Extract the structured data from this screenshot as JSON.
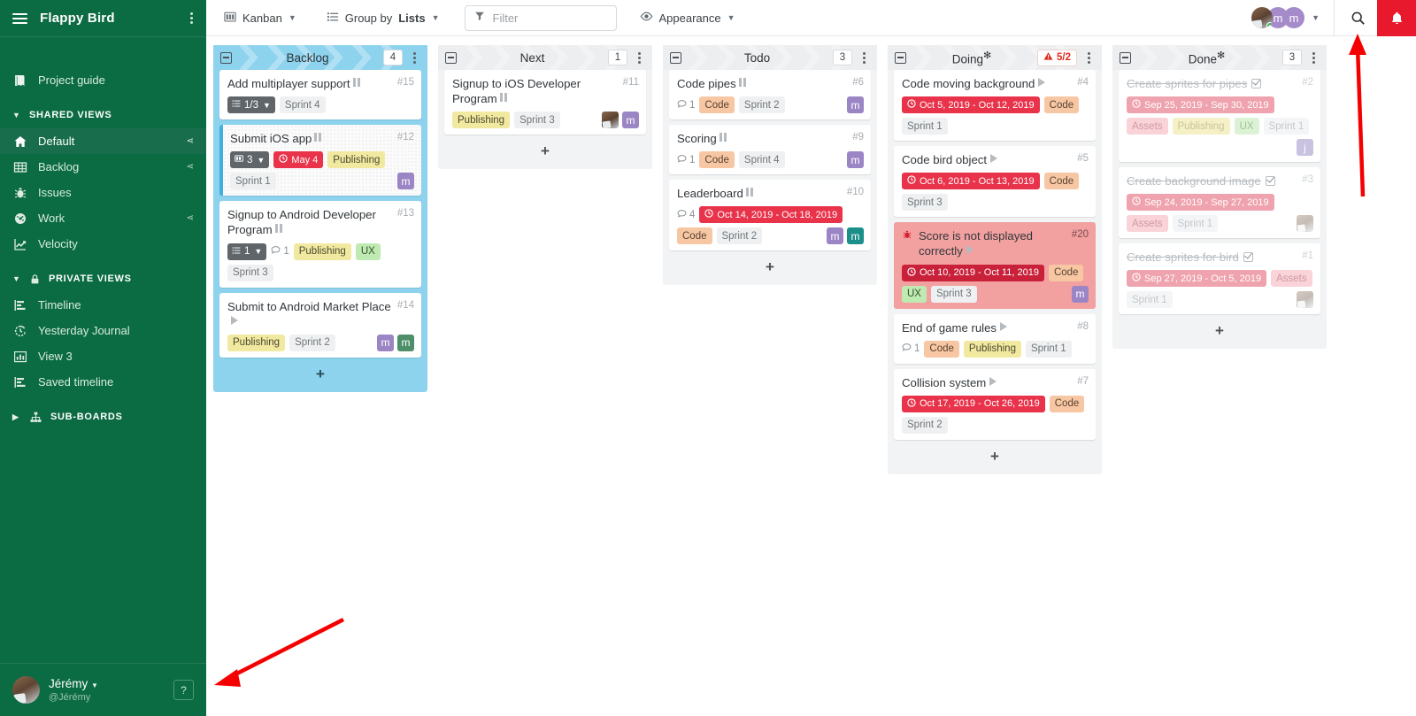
{
  "sidebar": {
    "board_title": "Flappy Bird",
    "project_guide": "Project guide",
    "shared_views_label": "SHARED VIEWS",
    "private_views_label": "PRIVATE VIEWS",
    "sub_boards_label": "SUB-BOARDS",
    "shared_views": [
      {
        "label": "Default",
        "icon": "home-icon",
        "shared": true,
        "active": true
      },
      {
        "label": "Backlog",
        "icon": "table-icon",
        "shared": true,
        "active": false
      },
      {
        "label": "Issues",
        "icon": "bug-icon",
        "shared": false,
        "active": false
      },
      {
        "label": "Work",
        "icon": "gauge-icon",
        "shared": true,
        "active": false
      },
      {
        "label": "Velocity",
        "icon": "line-chart-icon",
        "shared": false,
        "active": false
      }
    ],
    "private_views": [
      {
        "label": "Timeline",
        "icon": "timeline-icon"
      },
      {
        "label": "Yesterday Journal",
        "icon": "history-icon"
      },
      {
        "label": "View 3",
        "icon": "bar-chart-icon"
      },
      {
        "label": "Saved timeline",
        "icon": "timeline-icon"
      }
    ],
    "user": {
      "name": "Jérémy",
      "handle": "@Jérémy"
    },
    "help_label": "?"
  },
  "toolbar": {
    "view_mode": "Kanban",
    "group_by_prefix": "Group by",
    "group_by_value": "Lists",
    "filter_placeholder": "Filter",
    "filter_value": "",
    "appearance": "Appearance",
    "avatars": [
      "photo",
      "m",
      "m"
    ],
    "search_icon": "search-icon",
    "bell_icon": "bell-icon",
    "bell_color": "#e8192c"
  },
  "columns": [
    {
      "name": "Backlog",
      "count": "4",
      "starred": false,
      "style": "blue",
      "wip": null,
      "add_label": "+",
      "cards": [
        {
          "title": "Add multiplayer support",
          "id": "#15",
          "status_icon": "pause-icon",
          "style": "plain",
          "badges": [
            {
              "type": "checklist",
              "text": "1/3",
              "glyph": "list-icon"
            },
            {
              "type": "sprint",
              "text": "Sprint 4"
            }
          ],
          "avatars": []
        },
        {
          "title": "Submit iOS app",
          "id": "#12",
          "status_icon": "pause-icon",
          "style": "dotted",
          "badges": [
            {
              "type": "board",
              "text": "3",
              "glyph": "board-icon"
            },
            {
              "type": "date-red",
              "text": "May 4"
            },
            {
              "type": "publishing",
              "text": "Publishing"
            },
            {
              "type": "sprint",
              "text": "Sprint 1"
            }
          ],
          "avatars": [
            {
              "kind": "purple",
              "text": "m"
            }
          ]
        },
        {
          "title": "Signup to Android Developer Program",
          "id": "#13",
          "status_icon": "pause-icon",
          "style": "plain",
          "badges": [
            {
              "type": "checklist",
              "text": "1",
              "glyph": "list-icon"
            },
            {
              "type": "comment",
              "text": "1"
            },
            {
              "type": "publishing",
              "text": "Publishing"
            },
            {
              "type": "ux",
              "text": "UX"
            },
            {
              "type": "sprint",
              "text": "Sprint 3"
            }
          ],
          "avatars": []
        },
        {
          "title": "Submit to Android Market Place",
          "id": "#14",
          "status_icon": "play-icon",
          "style": "plain",
          "badges": [
            {
              "type": "publishing",
              "text": "Publishing"
            },
            {
              "type": "sprint",
              "text": "Sprint 2"
            }
          ],
          "avatars": [
            {
              "kind": "purple",
              "text": "m"
            },
            {
              "kind": "green",
              "text": "m"
            }
          ]
        }
      ]
    },
    {
      "name": "Next",
      "count": "1",
      "starred": false,
      "style": "grey",
      "wip": null,
      "add_label": "+",
      "cards": [
        {
          "title": "Signup to iOS Developer Program",
          "id": "#11",
          "status_icon": "pause-icon",
          "style": "plain",
          "badges": [
            {
              "type": "publishing",
              "text": "Publishing"
            },
            {
              "type": "sprint",
              "text": "Sprint 3"
            }
          ],
          "avatars": [
            {
              "kind": "photo",
              "text": ""
            },
            {
              "kind": "purple",
              "text": "m"
            }
          ]
        }
      ]
    },
    {
      "name": "Todo",
      "count": "3",
      "starred": false,
      "style": "grey",
      "wip": null,
      "add_label": "+",
      "cards": [
        {
          "title": "Code pipes",
          "id": "#6",
          "status_icon": "pause-icon",
          "style": "plain",
          "badges": [
            {
              "type": "comment",
              "text": "1"
            },
            {
              "type": "code",
              "text": "Code"
            },
            {
              "type": "sprint",
              "text": "Sprint 2"
            }
          ],
          "avatars": [
            {
              "kind": "purple",
              "text": "m"
            }
          ]
        },
        {
          "title": "Scoring",
          "id": "#9",
          "status_icon": "pause-icon",
          "style": "plain",
          "badges": [
            {
              "type": "comment",
              "text": "1"
            },
            {
              "type": "code",
              "text": "Code"
            },
            {
              "type": "sprint",
              "text": "Sprint 4"
            }
          ],
          "avatars": [
            {
              "kind": "purple",
              "text": "m"
            }
          ]
        },
        {
          "title": "Leaderboard",
          "id": "#10",
          "status_icon": "pause-icon",
          "style": "plain",
          "badges": [
            {
              "type": "comment",
              "text": "4"
            },
            {
              "type": "date-red",
              "text": "Oct 14, 2019 - Oct 18, 2019"
            },
            {
              "type": "code",
              "text": "Code"
            },
            {
              "type": "sprint",
              "text": "Sprint 2"
            }
          ],
          "avatars": [
            {
              "kind": "purple",
              "text": "m"
            },
            {
              "kind": "teal",
              "text": "m"
            }
          ]
        }
      ]
    },
    {
      "name": "Doing",
      "count": null,
      "starred": true,
      "style": "grey",
      "wip": "5/2",
      "add_label": "+",
      "cards": [
        {
          "title": "Code moving background",
          "id": "#4",
          "status_icon": "play-icon",
          "style": "plain",
          "badges": [
            {
              "type": "date-red",
              "text": "Oct 5, 2019 - Oct 12, 2019"
            },
            {
              "type": "code",
              "text": "Code"
            },
            {
              "type": "sprint",
              "text": "Sprint 1"
            }
          ],
          "avatars": []
        },
        {
          "title": "Code bird object",
          "id": "#5",
          "status_icon": "play-icon",
          "style": "plain",
          "badges": [
            {
              "type": "date-red",
              "text": "Oct 6, 2019 - Oct 13, 2019"
            },
            {
              "type": "code",
              "text": "Code"
            },
            {
              "type": "sprint",
              "text": "Sprint 3"
            }
          ],
          "avatars": []
        },
        {
          "title": "Score is not displayed correctly",
          "id": "#20",
          "status_icon": "play-icon",
          "style": "bug",
          "type_icon": "bug-icon",
          "badges": [
            {
              "type": "date-dark",
              "text": "Oct 10, 2019 - Oct 11, 2019"
            },
            {
              "type": "code",
              "text": "Code"
            },
            {
              "type": "ux",
              "text": "UX"
            },
            {
              "type": "sprint",
              "text": "Sprint 3"
            }
          ],
          "avatars": [
            {
              "kind": "purple",
              "text": "m"
            }
          ]
        },
        {
          "title": "End of game rules",
          "id": "#8",
          "status_icon": "play-icon",
          "style": "plain",
          "badges": [
            {
              "type": "comment",
              "text": "1"
            },
            {
              "type": "code",
              "text": "Code"
            },
            {
              "type": "publishing",
              "text": "Publishing"
            },
            {
              "type": "sprint",
              "text": "Sprint 1"
            }
          ],
          "avatars": []
        },
        {
          "title": "Collision system",
          "id": "#7",
          "status_icon": "play-icon",
          "style": "plain",
          "badges": [
            {
              "type": "date-red",
              "text": "Oct 17, 2019 - Oct 26, 2019"
            },
            {
              "type": "code",
              "text": "Code"
            },
            {
              "type": "sprint",
              "text": "Sprint 2"
            }
          ],
          "avatars": []
        }
      ]
    },
    {
      "name": "Done",
      "count": "3",
      "starred": true,
      "style": "grey",
      "wip": null,
      "add_label": "+",
      "cards": [
        {
          "title": "Create sprites for pipes",
          "id": "#2",
          "status_icon": "check-icon",
          "style": "done",
          "badges": [
            {
              "type": "date-faded",
              "text": "Sep 25, 2019 - Sep 30, 2019"
            },
            {
              "type": "assets-faded",
              "text": "Assets"
            },
            {
              "type": "publishing-faded",
              "text": "Publishing"
            },
            {
              "type": "ux-faded",
              "text": "UX"
            },
            {
              "type": "sprint-faded",
              "text": "Sprint 1"
            }
          ],
          "avatars": [
            {
              "kind": "lav",
              "text": "j"
            }
          ]
        },
        {
          "title": "Create background image",
          "id": "#3",
          "status_icon": "check-icon",
          "style": "done",
          "badges": [
            {
              "type": "date-faded",
              "text": "Sep 24, 2019 - Sep 27, 2019"
            },
            {
              "type": "assets-faded",
              "text": "Assets"
            },
            {
              "type": "sprint-faded",
              "text": "Sprint 1"
            }
          ],
          "avatars": [
            {
              "kind": "photo-faded",
              "text": ""
            }
          ]
        },
        {
          "title": "Create sprites for bird",
          "id": "#1",
          "status_icon": "check-icon",
          "style": "done",
          "badges": [
            {
              "type": "date-faded",
              "text": "Sep 27, 2019 - Oct 5, 2019"
            },
            {
              "type": "assets-faded",
              "text": "Assets"
            },
            {
              "type": "sprint-faded",
              "text": "Sprint 1"
            }
          ],
          "avatars": [
            {
              "kind": "photo-faded",
              "text": ""
            }
          ]
        }
      ]
    }
  ],
  "annotations": {
    "arrow_color": "#f50000",
    "arrow_up_target": "notification-bell-area",
    "arrow_left_target": "help-button-area"
  }
}
